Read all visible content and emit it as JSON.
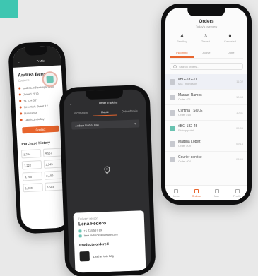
{
  "colors": {
    "accent_teal": "#3ec6b1",
    "brand_orange": "#e8652d",
    "phone_frame": "#0f0f10"
  },
  "left_screen": {
    "back_icon": "back-arrow-icon",
    "title": "Profile",
    "profile_name": "Andrea Benson",
    "profile_sub": "Customer",
    "info_rows": [
      "andrea.b@example.com",
      "Joined 2019",
      "+1 234 567",
      "New York Street 12",
      "Manhattan",
      "Last login today"
    ],
    "button_label": "Contact",
    "section_title": "Purchase history",
    "grid": [
      [
        "1,234",
        "4,567"
      ],
      [
        "1,222",
        "3,345"
      ],
      [
        "8,765",
        "2,109"
      ],
      [
        "1,200",
        "6,543"
      ]
    ]
  },
  "center_screen": {
    "back_icon": "back-arrow-icon",
    "title": "Order Tracking",
    "tabs": [
      "Information",
      "Route",
      "Order details"
    ],
    "active_tab": 1,
    "select_value": "Andrea Barker Bay",
    "pin_icon": "location-pin-icon",
    "card_label": "Delivery person",
    "person_name": "Lena Fedoro",
    "phone": "+1 234 567 89",
    "email": "lena.fedoro@example.com",
    "section_title": "Products ordered",
    "product_name": "Leather tote bag"
  },
  "right_screen": {
    "title": "Orders",
    "subtitle": "Today's overview",
    "stats": [
      {
        "num": "4",
        "lbl": "Pending"
      },
      {
        "num": "3",
        "lbl": "Transit"
      },
      {
        "num": "0",
        "lbl": "Canceled"
      }
    ],
    "tabs": [
      "Incoming",
      "Active",
      "Done"
    ],
    "search_placeholder": "Search orders...",
    "orders": [
      {
        "title": "#BG-182-11",
        "sub": "Mia Thompson",
        "time": "11:02",
        "highlight": true
      },
      {
        "title": "Manuel Ramos",
        "sub": "Order #21",
        "time": "10:48"
      },
      {
        "title": "Cynthia TSOLE",
        "sub": "Order #15",
        "time": "10:31"
      },
      {
        "title": "#BG-182-45",
        "sub": "Pickup point",
        "time": "09:56"
      },
      {
        "title": "Martina Lopez",
        "sub": "Order #09",
        "time": "09:14"
      },
      {
        "title": "Courier service",
        "sub": "Order #04",
        "time": "08:40"
      }
    ],
    "nav": [
      "Home",
      "Orders",
      "Map",
      "Profile"
    ],
    "active_nav": 1
  }
}
